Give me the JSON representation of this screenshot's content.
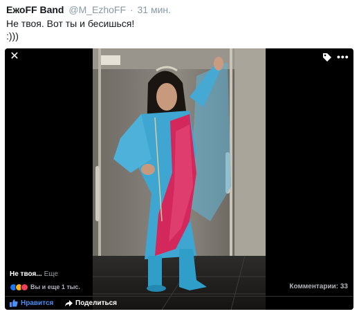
{
  "tweet": {
    "author": "ЕжоFF Band",
    "handle": "@M_EzhoFF",
    "separator": "·",
    "time": "31 мин.",
    "text_lines": [
      "Не твоя. Вот ты и бесишься!",
      ":)))"
    ]
  },
  "viewer": {
    "close_symbol": "✕",
    "more_symbol": "•••",
    "icons": {
      "close": "close-icon",
      "tag": "tag-icon",
      "more": "more-icon"
    },
    "caption": "Не твоя...",
    "caption_more": "Еще",
    "reactions_text": "Вы и еще 1 тыс.",
    "comments": "Комментарии: 33",
    "actions": {
      "like": "Нравится",
      "share": "Поделиться"
    }
  },
  "colors": {
    "like_blue": "#4b8ef4",
    "reaction_like": "#1877f2",
    "reaction_haha": "#f7b125",
    "reaction_love": "#f33e58",
    "muted": "#8899a6"
  }
}
